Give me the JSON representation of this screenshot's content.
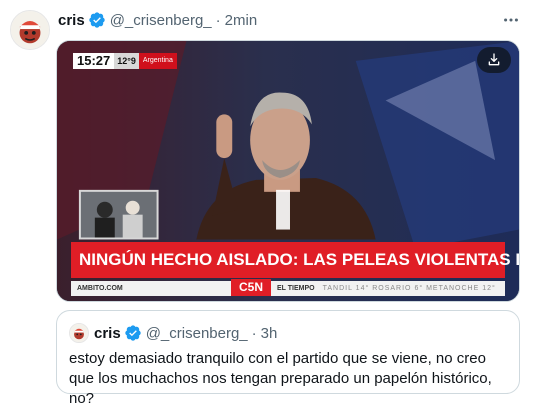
{
  "author": {
    "name": "cris",
    "handle": "@_crisenberg_",
    "separator": "·",
    "time": "2min"
  },
  "media": {
    "clock": {
      "time": "15:27",
      "temp": "12°9",
      "place": "Argentina"
    },
    "headline": "NINGÚN HECHO AISLADO: LAS PELEAS VIOLENTAS DE VILA",
    "ticker": {
      "site": "AMBITO.COM",
      "channel": "C5N",
      "weather": "EL TIEMPO",
      "extra": "TANDIL 14° ROSARIO 6° METANOCHE 12°"
    }
  },
  "quoted": {
    "name": "cris",
    "handle": "@_crisenberg_",
    "separator": "·",
    "time": "3h",
    "text": "estoy demasiado tranquilo con el partido que se viene, no creo que los muchachos nos tengan preparado un papelón histórico, no?"
  },
  "icons": {
    "verified": "verified-badge-icon",
    "more": "more-options-icon",
    "download": "download-icon"
  },
  "colors": {
    "verified": "#1d9bf0",
    "text": "#0f1419",
    "secondary": "#536471",
    "headline_bar": "#e01e26",
    "border": "#cfd9de"
  }
}
